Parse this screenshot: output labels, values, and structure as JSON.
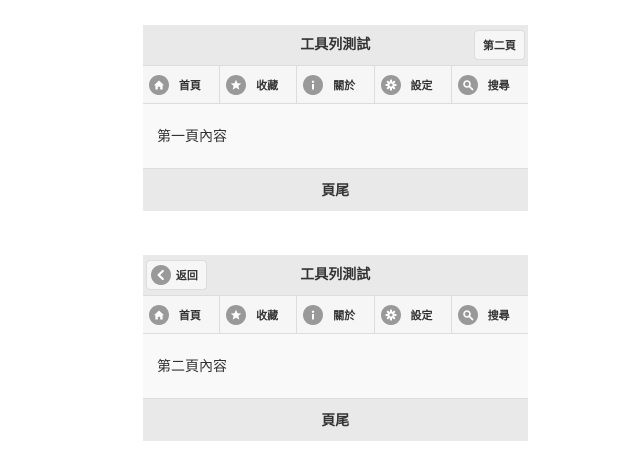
{
  "colors": {
    "header_bg": "#e9e9e9",
    "icon_circle": "#999999",
    "button_bg": "#f6f6f6",
    "content_bg": "#f9f9f9",
    "border": "#dddddd"
  },
  "page1": {
    "header": {
      "title": "工具列測試",
      "right_button": "第二頁"
    },
    "navbar": [
      {
        "label": "首頁",
        "icon": "home-icon"
      },
      {
        "label": "收藏",
        "icon": "star-icon"
      },
      {
        "label": "關於",
        "icon": "info-icon"
      },
      {
        "label": "設定",
        "icon": "gear-icon"
      },
      {
        "label": "搜尋",
        "icon": "search-icon"
      }
    ],
    "content": "第一頁內容",
    "footer": "頁尾"
  },
  "page2": {
    "header": {
      "title": "工具列測試",
      "left_button": "返回",
      "left_icon": "back-arrow-icon"
    },
    "navbar": [
      {
        "label": "首頁",
        "icon": "home-icon"
      },
      {
        "label": "收藏",
        "icon": "star-icon"
      },
      {
        "label": "關於",
        "icon": "info-icon"
      },
      {
        "label": "設定",
        "icon": "gear-icon"
      },
      {
        "label": "搜尋",
        "icon": "search-icon"
      }
    ],
    "content": "第二頁內容",
    "footer": "頁尾"
  }
}
